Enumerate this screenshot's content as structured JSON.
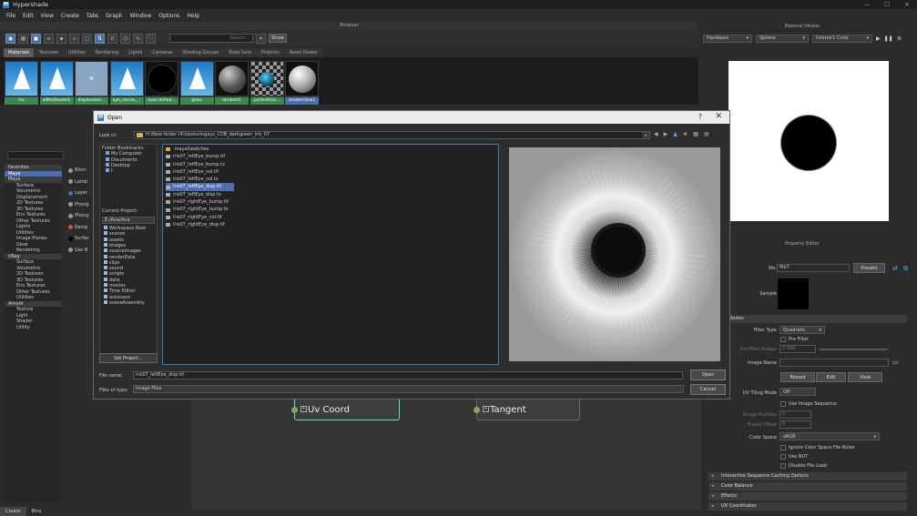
{
  "app": {
    "title": "Hypershade",
    "logo": "M",
    "window_controls": [
      "—",
      "☐",
      "✕"
    ]
  },
  "menu": [
    "File",
    "Edit",
    "View",
    "Create",
    "Tabs",
    "Graph",
    "Window",
    "Options",
    "Help"
  ],
  "browser": {
    "title": "Browser",
    "search_placeholder": "Search...",
    "show_label": "Show"
  },
  "tabs": [
    "Materials",
    "Textures",
    "Utilities",
    "Rendering",
    "Lights",
    "Cameras",
    "Shading Groups",
    "Bake Sets",
    "Projects",
    "Asset Nodes"
  ],
  "materials": [
    {
      "name": "iris",
      "kind": "tile"
    },
    {
      "name": "aiMixShader1",
      "kind": "tile"
    },
    {
      "name": "displaceme...",
      "kind": "cube"
    },
    {
      "name": "eye_cornia_...",
      "kind": "tile"
    },
    {
      "name": "eyec:defaul...",
      "kind": "black"
    },
    {
      "name": "glass",
      "kind": "tile"
    },
    {
      "name": "lambert1",
      "kind": "grey"
    },
    {
      "name": "particleClo...",
      "kind": "checker"
    },
    {
      "name": "shaderGlow1",
      "kind": "glow",
      "selected": true
    }
  ],
  "tree": [
    {
      "t": "hdr",
      "label": "Favorites"
    },
    {
      "t": "hdr",
      "label": "Maya",
      "selected": true
    },
    {
      "t": "hdr",
      "label": "Maya"
    },
    {
      "t": "it",
      "label": "Surface"
    },
    {
      "t": "it",
      "label": "Volumetric"
    },
    {
      "t": "it",
      "label": "Displacement"
    },
    {
      "t": "it",
      "label": "2D Textures"
    },
    {
      "t": "it",
      "label": "3D Textures"
    },
    {
      "t": "it",
      "label": "Env Textures"
    },
    {
      "t": "it",
      "label": "Other Textures"
    },
    {
      "t": "it",
      "label": "Lights"
    },
    {
      "t": "it",
      "label": "Utilities"
    },
    {
      "t": "it",
      "label": "Image Planes"
    },
    {
      "t": "it",
      "label": "Glow"
    },
    {
      "t": "it",
      "label": "Rendering"
    },
    {
      "t": "hdr",
      "label": "VRay"
    },
    {
      "t": "it",
      "label": "Surface"
    },
    {
      "t": "it",
      "label": "Volumetric"
    },
    {
      "t": "it",
      "label": "2D Textures"
    },
    {
      "t": "it",
      "label": "3D Textures"
    },
    {
      "t": "it",
      "label": "Env Textures"
    },
    {
      "t": "it",
      "label": "Other Textures"
    },
    {
      "t": "it",
      "label": "Utilities"
    },
    {
      "t": "hdr",
      "label": "Arnold"
    },
    {
      "t": "it",
      "label": "Texture"
    },
    {
      "t": "it",
      "label": "Light"
    },
    {
      "t": "it",
      "label": "Shader"
    },
    {
      "t": "it",
      "label": "Utility"
    }
  ],
  "node_list": [
    {
      "label": "Blinn",
      "color": "#9a9a9a"
    },
    {
      "label": "Lamb",
      "color": "#9a9a9a"
    },
    {
      "label": "Layer",
      "color": "#4b6fb0"
    },
    {
      "label": "Phong",
      "color": "#9a9a9a"
    },
    {
      "label": "Phong",
      "color": "#9a9a9a"
    },
    {
      "label": "Ramp",
      "color": "#d0573a"
    },
    {
      "label": "Surfac",
      "color": "#000000"
    },
    {
      "label": "Use B",
      "color": "#9a9a9a"
    }
  ],
  "graph": {
    "nodes": [
      {
        "label": "Uv Coord",
        "selected": true
      },
      {
        "label": "Tangent"
      }
    ]
  },
  "bottom_tabs": [
    "Create",
    "Bins"
  ],
  "material_viewer": {
    "title": "Material Viewer",
    "renderer": "Hardware",
    "shape": "Sphere",
    "env": "Interior1 Color"
  },
  "property_editor": {
    "title": "Property Editor",
    "file_label": "file:",
    "file_value": "file7",
    "presets": "Presets",
    "sample_label": "Sample",
    "attributes": "Attributes",
    "filter_type_label": "Filter Type",
    "filter_type": "Quadratic",
    "pre_filter": "Pre Filter",
    "pre_filter_radius_label": "Pre Filter Radius",
    "pre_filter_radius": "2.000",
    "image_name_label": "Image Name",
    "reload": "Reload",
    "edit": "Edit",
    "view": "View",
    "uv_tiling_label": "UV Tiling Mode",
    "uv_tiling": "Off",
    "use_seq": "Use Image Sequence",
    "image_number_label": "Image Number",
    "image_number": "0",
    "frame_offset_label": "Frame Offset",
    "frame_offset": "0",
    "color_space_label": "Color Space",
    "color_space": "sRGB",
    "ignore_cs": "Ignore Color Space File Rules",
    "use_bot": "Use BOT",
    "disable_load": "Disable File Load",
    "sections": [
      "Interactive Sequence Caching Options",
      "Color Balance",
      "Effects",
      "UV Coordinates"
    ]
  },
  "dialog": {
    "title": "Open",
    "logo": "M",
    "help": "?",
    "close": "✕",
    "look_in_label": "Look in:",
    "look_in": "H:\\New folder (4)\\texturingxyz_CDB_darkgreen_iris_07",
    "nav_icons": [
      "◀",
      "▶",
      "▲",
      "★",
      "▦",
      "▤"
    ],
    "bookmarks_label": "Folder Bookmarks:",
    "bookmarks": [
      "My Computer",
      "Documents",
      "Desktop",
      "I:"
    ],
    "current_project_label": "Current Project:",
    "current_project": "E:/Ana/Ana",
    "project_dirs": [
      "Workspace Root",
      "scenes",
      "assets",
      "images",
      "sourceimages",
      "renderData",
      "clips",
      "sound",
      "scripts",
      "data",
      "movies",
      "Time Editor",
      "autosave",
      "sceneAssembly"
    ],
    "set_project": "Set Project...",
    "files": [
      {
        "name": ".mayaSwatches",
        "folder": true
      },
      {
        "name": "iris07_leftEye_bump.tif"
      },
      {
        "name": "iris07_leftEye_bump.tx"
      },
      {
        "name": "iris07_leftEye_col.tif"
      },
      {
        "name": "iris07_leftEye_col.tx"
      },
      {
        "name": "iris07_leftEye_disp.tif",
        "selected": true
      },
      {
        "name": "iris07_leftEye_disp.tx"
      },
      {
        "name": "iris07_rightEye_bump.tif"
      },
      {
        "name": "iris07_rightEye_bump.tx"
      },
      {
        "name": "iris07_rightEye_col.tif"
      },
      {
        "name": "iris07_rightEye_disp.tif"
      }
    ],
    "file_name_label": "File name:",
    "file_name": "iris07_leftEye_disp.tif",
    "files_of_type_label": "Files of type:",
    "files_of_type": "Image Files",
    "open": "Open",
    "cancel": "Cancel"
  }
}
